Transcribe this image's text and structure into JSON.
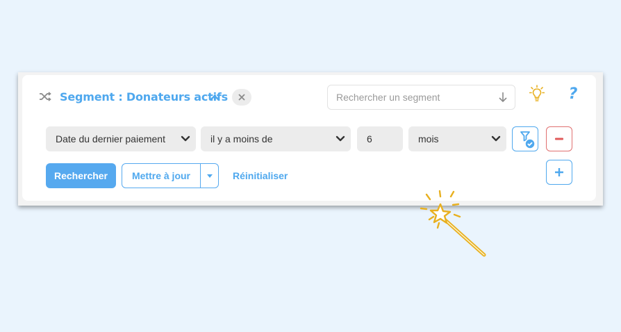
{
  "segment": {
    "title": "Segment : Donateurs actifs",
    "search_placeholder": "Rechercher un segment",
    "accent_color": "#4fa8ee",
    "icons": [
      "shuffle-icon",
      "chevron-up-icon",
      "close-icon",
      "arrow-down-icon",
      "lightbulb-icon",
      "help-icon"
    ],
    "help_label": "?"
  },
  "condition": {
    "field": "Date du dernier paiement",
    "operator": "il y a moins de",
    "value": "6",
    "unit": "mois"
  },
  "actions": {
    "search_label": "Rechercher",
    "update_label": "Mettre à jour",
    "reset_label": "Réinitialiser"
  }
}
